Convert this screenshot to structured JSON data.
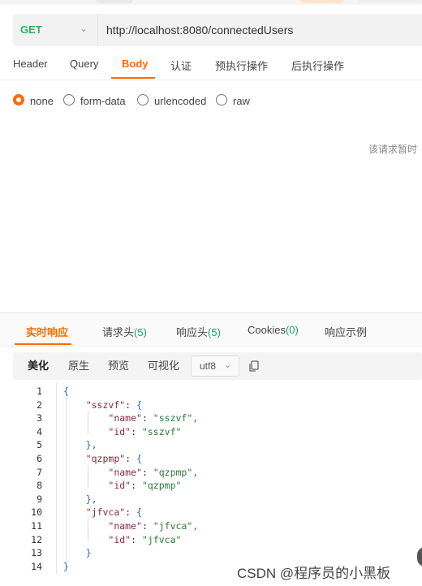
{
  "request": {
    "method": "GET",
    "url": "http://localhost:8080/connectedUsers"
  },
  "request_tabs": [
    {
      "label": "Header"
    },
    {
      "label": "Query"
    },
    {
      "label": "Body"
    },
    {
      "label": "认证"
    },
    {
      "label": "预执行操作"
    },
    {
      "label": "后执行操作"
    }
  ],
  "body_types": [
    {
      "label": "none"
    },
    {
      "label": "form-data"
    },
    {
      "label": "urlencoded"
    },
    {
      "label": "raw"
    }
  ],
  "body_empty_note": "该请求暂时",
  "response_tabs": [
    {
      "label": "实时响应",
      "count": ""
    },
    {
      "label": "请求头",
      "count": "(5)"
    },
    {
      "label": "响应头",
      "count": "(5)"
    },
    {
      "label": "Cookies",
      "count": "(0)"
    },
    {
      "label": "响应示例",
      "count": ""
    }
  ],
  "view_buttons": [
    {
      "label": "美化"
    },
    {
      "label": "原生"
    },
    {
      "label": "预览"
    },
    {
      "label": "可视化"
    }
  ],
  "encoding": "utf8",
  "code_lines": [
    {
      "n": "1",
      "text": "{"
    },
    {
      "n": "2",
      "text": "    \"sszvf\": {"
    },
    {
      "n": "3",
      "text": "        \"name\": \"sszvf\","
    },
    {
      "n": "4",
      "text": "        \"id\": \"sszvf\""
    },
    {
      "n": "5",
      "text": "    },"
    },
    {
      "n": "6",
      "text": "    \"qzpmp\": {"
    },
    {
      "n": "7",
      "text": "        \"name\": \"qzpmp\","
    },
    {
      "n": "8",
      "text": "        \"id\": \"qzpmp\""
    },
    {
      "n": "9",
      "text": "    },"
    },
    {
      "n": "10",
      "text": "    \"jfvca\": {"
    },
    {
      "n": "11",
      "text": "        \"name\": \"jfvca\","
    },
    {
      "n": "12",
      "text": "        \"id\": \"jfvca\""
    },
    {
      "n": "13",
      "text": "    }"
    },
    {
      "n": "14",
      "text": "}"
    }
  ],
  "watermark": "CSDN @程序员的小黑板",
  "colors": {
    "accent": "#ff6a00",
    "method_get": "#26b35f",
    "count": "#1aa260"
  }
}
